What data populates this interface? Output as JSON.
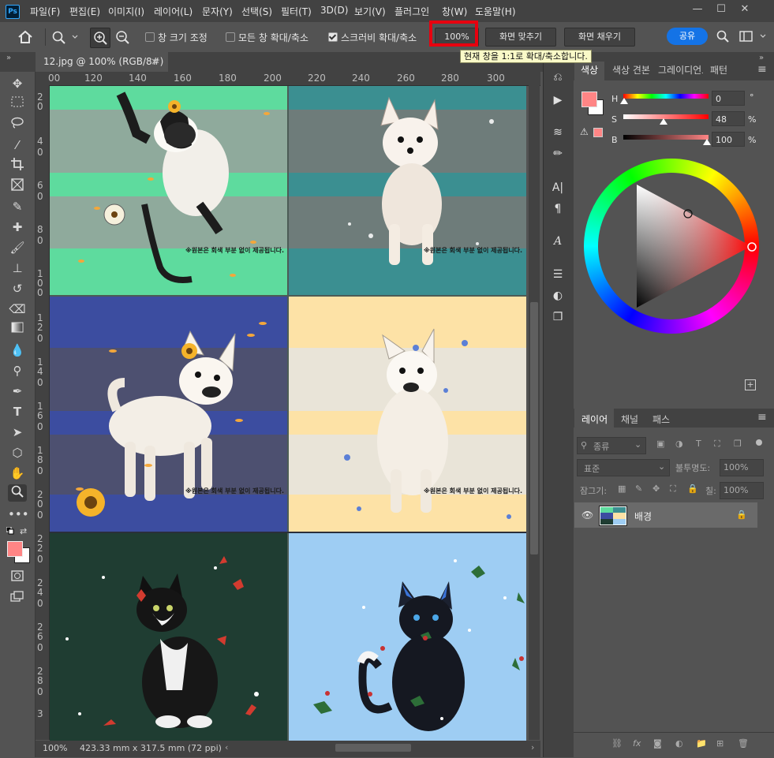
{
  "app": {
    "logo_text": "Ps"
  },
  "menu": [
    "파일(F)",
    "편집(E)",
    "이미지(I)",
    "레이어(L)",
    "문자(Y)",
    "선택(S)",
    "필터(T)",
    "3D(D)",
    "보기(V)",
    "플러그인",
    "창(W)",
    "도움말(H)"
  ],
  "window_controls": {
    "minimize": "—",
    "maximize": "☐",
    "close": "✕"
  },
  "options": {
    "resize_windows_label": "창 크기 조정",
    "zoom_all_windows_label": "모든 창 확대/축소",
    "scrubby_zoom_label": "스크러비 확대/축소",
    "zoom_value": "100%",
    "fit_screen_label": "화면 맞추기",
    "fill_screen_label": "화면 채우기",
    "share_label": "공유",
    "tooltip": "현재 창을 1:1로 확대/축소합니다."
  },
  "document_tab": {
    "title": "12.jpg @ 100% (RGB/8#)",
    "close": "×"
  },
  "ruler": {
    "h_labels": [
      "00",
      "120",
      "140",
      "160",
      "180",
      "200",
      "220",
      "240",
      "260",
      "280",
      "300"
    ],
    "v_labels": [
      "2",
      "0",
      "4",
      "0",
      "6",
      "0",
      "8",
      "0",
      "1",
      "0",
      "0",
      "1",
      "2",
      "0",
      "1",
      "4",
      "0",
      "1",
      "6",
      "0",
      "1",
      "8",
      "0",
      "2",
      "0",
      "0",
      "2",
      "2",
      "0",
      "2",
      "4",
      "0",
      "2",
      "6",
      "0",
      "2",
      "8",
      "0",
      "3"
    ]
  },
  "canvas": {
    "watermark": "※원본은 회색 부분 없이 제공됩니다.",
    "panels": [
      {
        "subject": "siamese-cat",
        "bg": "#5edb9e",
        "band": "#7a9e8c"
      },
      {
        "subject": "chihuahua-dog",
        "bg": "#3b8f91",
        "band": "#6e7c7a"
      },
      {
        "subject": "white-dog-sunflower",
        "bg": "#3c4da0",
        "band": "#4d5070"
      },
      {
        "subject": "white-dog-sitting",
        "bg": "#fde2a6",
        "band": "#e9e4d8"
      },
      {
        "subject": "tuxedo-cat-poinsettia",
        "bg": "#1f3d32"
      },
      {
        "subject": "black-cat-holly",
        "bg": "#9ecdf3"
      }
    ]
  },
  "status": {
    "zoom": "100%",
    "doc_size": "423.33 mm x 317.5 mm (72 ppi)"
  },
  "color_panel": {
    "tabs": [
      "색상",
      "색상 견본",
      "그레이디언트",
      "패턴"
    ],
    "h_label": "H",
    "h_value": "0",
    "h_unit": "°",
    "s_label": "S",
    "s_value": "48",
    "s_unit": "%",
    "b_label": "B",
    "b_value": "100",
    "b_unit": "%",
    "foreground": "#ff8585",
    "background": "#ffffff"
  },
  "layers_panel": {
    "tabs": [
      "레이어",
      "채널",
      "패스"
    ],
    "filter_label": "종류",
    "blend_mode": "표준",
    "opacity_label": "불투명도:",
    "opacity_value": "100%",
    "lock_label": "잠그기:",
    "fill_label": "칠:",
    "fill_value": "100%",
    "layers": [
      {
        "name": "배경",
        "locked": true,
        "visible": true
      }
    ]
  }
}
